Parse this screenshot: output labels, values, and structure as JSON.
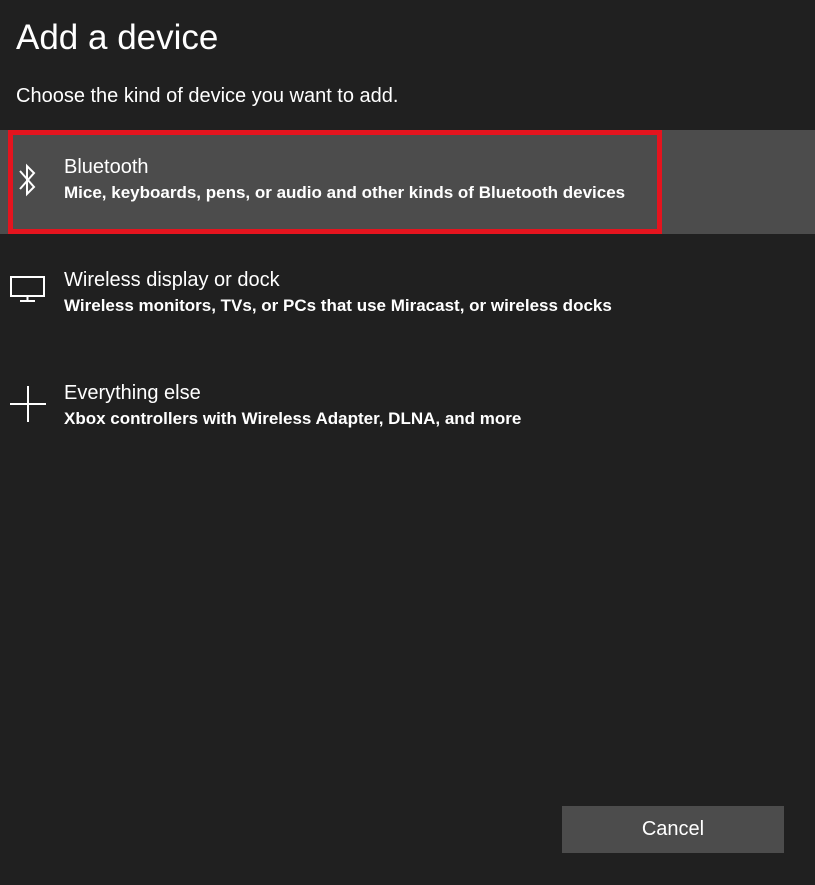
{
  "dialog": {
    "title": "Add a device",
    "subtitle": "Choose the kind of device you want to add."
  },
  "options": [
    {
      "icon": "bluetooth-icon",
      "title": "Bluetooth",
      "description": "Mice, keyboards, pens, or audio and other kinds of Bluetooth devices",
      "selected": true
    },
    {
      "icon": "monitor-icon",
      "title": "Wireless display or dock",
      "description": "Wireless monitors, TVs, or PCs that use Miracast, or wireless docks",
      "selected": false
    },
    {
      "icon": "plus-icon",
      "title": "Everything else",
      "description": "Xbox controllers with Wireless Adapter, DLNA, and more",
      "selected": false
    }
  ],
  "footer": {
    "cancel_label": "Cancel"
  },
  "colors": {
    "background": "#202020",
    "selected_background": "#4c4c4c",
    "highlight_border": "#e4141e",
    "button_background": "#4c4c4c",
    "text": "#ffffff"
  }
}
